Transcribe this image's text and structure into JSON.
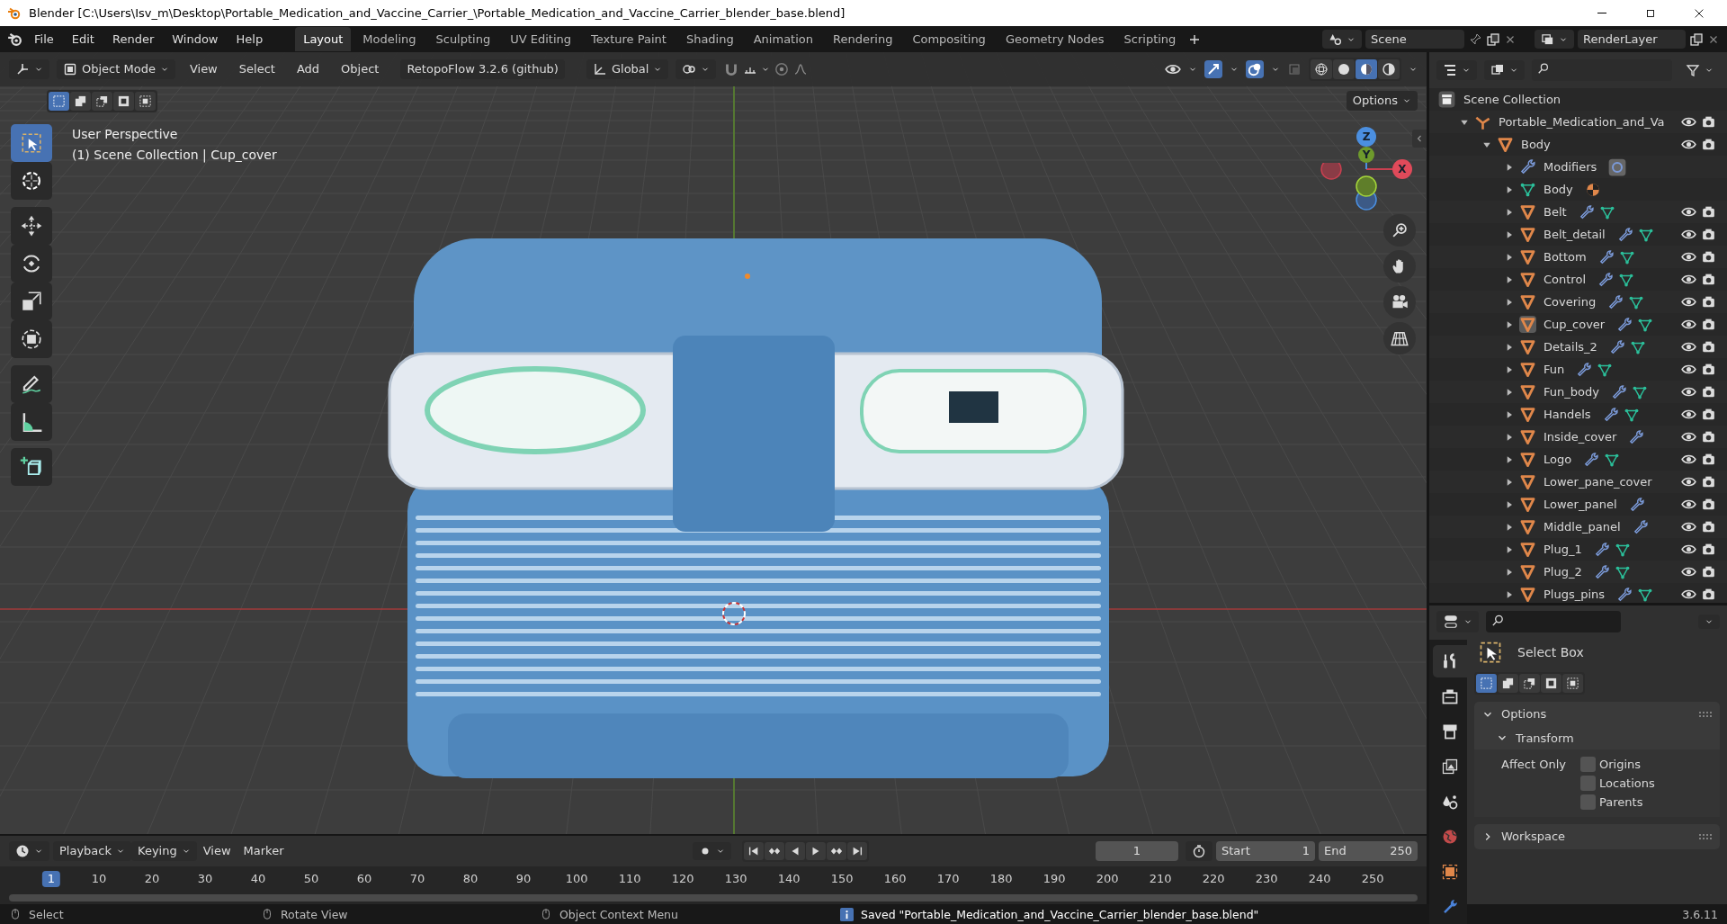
{
  "window": {
    "title": "Blender [C:\\Users\\Isv_m\\Desktop\\Portable_Medication_and_Vaccine_Carrier_\\Portable_Medication_and_Vaccine_Carrier_blender_base.blend]"
  },
  "menu": [
    "File",
    "Edit",
    "Render",
    "Window",
    "Help"
  ],
  "workspaces": [
    {
      "label": "Layout",
      "selected": true
    },
    {
      "label": "Modeling",
      "selected": false
    },
    {
      "label": "Sculpting",
      "selected": false
    },
    {
      "label": "UV Editing",
      "selected": false
    },
    {
      "label": "Texture Paint",
      "selected": false
    },
    {
      "label": "Shading",
      "selected": false
    },
    {
      "label": "Animation",
      "selected": false
    },
    {
      "label": "Rendering",
      "selected": false
    },
    {
      "label": "Compositing",
      "selected": false
    },
    {
      "label": "Geometry Nodes",
      "selected": false
    },
    {
      "label": "Scripting",
      "selected": false
    }
  ],
  "scene": {
    "name": "Scene",
    "view_layer": "RenderLayer"
  },
  "viewport_header": {
    "mode": "Object Mode",
    "menus": [
      "View",
      "Select",
      "Add",
      "Object"
    ],
    "addon": "RetopoFlow 3.2.6 (github)",
    "orientation": "Global",
    "shading": [
      {
        "kind": "wireframe",
        "selected": false
      },
      {
        "kind": "solid",
        "selected": false
      },
      {
        "kind": "material",
        "selected": true
      },
      {
        "kind": "rendered",
        "selected": false
      }
    ],
    "select_modes": [
      {
        "selected": true
      },
      {
        "selected": false
      },
      {
        "selected": false
      },
      {
        "selected": false
      },
      {
        "selected": false
      }
    ],
    "options": "Options"
  },
  "viewport": {
    "view_name": "User Perspective",
    "context": "(1) Scene Collection | Cup_cover",
    "tools": [
      {
        "kind": "select_box",
        "selected": true
      },
      {
        "kind": "cursor",
        "selected": false
      },
      {
        "kind": "move",
        "selected": false
      },
      {
        "kind": "rotate",
        "selected": false
      },
      {
        "kind": "scale",
        "selected": false
      },
      {
        "kind": "transform",
        "selected": false
      },
      {
        "kind": "annotate",
        "selected": false
      },
      {
        "kind": "measure",
        "selected": false
      },
      {
        "kind": "add_cube",
        "selected": false
      }
    ],
    "axes": [
      {
        "kind": "z",
        "label": "Z"
      },
      {
        "kind": "y",
        "label": "Y"
      },
      {
        "kind": "x",
        "label": "X"
      }
    ]
  },
  "outliner": {
    "root": "Scene Collection",
    "items": [
      {
        "name": "Portable_Medication_and_Va",
        "kind": "empty",
        "expanded": true,
        "children": [
          {
            "name": "Body",
            "kind": "object",
            "expanded": true,
            "active": false,
            "modifier": false,
            "mesh": false,
            "children": [
              {
                "name": "Modifiers",
                "kind": "modifiers",
                "expanded": false
              },
              {
                "name": "Body",
                "kind": "mesh_data",
                "expanded": false
              },
              {
                "name": "Belt",
                "kind": "object",
                "expanded": false,
                "active": false,
                "modifier": true,
                "mesh": true
              },
              {
                "name": "Belt_detail",
                "kind": "object",
                "expanded": false,
                "active": false,
                "modifier": true,
                "mesh": true
              },
              {
                "name": "Bottom",
                "kind": "object",
                "expanded": false,
                "active": false,
                "modifier": true,
                "mesh": true
              },
              {
                "name": "Control",
                "kind": "object",
                "expanded": false,
                "active": false,
                "modifier": true,
                "mesh": true
              },
              {
                "name": "Covering",
                "kind": "object",
                "expanded": false,
                "active": false,
                "modifier": true,
                "mesh": true
              },
              {
                "name": "Cup_cover",
                "kind": "object",
                "expanded": false,
                "active": true,
                "modifier": true,
                "mesh": true
              },
              {
                "name": "Details_2",
                "kind": "object",
                "expanded": false,
                "active": false,
                "modifier": true,
                "mesh": true
              },
              {
                "name": "Fun",
                "kind": "object",
                "expanded": false,
                "active": false,
                "modifier": true,
                "mesh": true
              },
              {
                "name": "Fun_body",
                "kind": "object",
                "expanded": false,
                "active": false,
                "modifier": true,
                "mesh": true
              },
              {
                "name": "Handels",
                "kind": "object",
                "expanded": false,
                "active": false,
                "modifier": true,
                "mesh": true
              },
              {
                "name": "Inside_cover",
                "kind": "object",
                "expanded": false,
                "active": false,
                "modifier": true,
                "mesh": false
              },
              {
                "name": "Logo",
                "kind": "object",
                "expanded": false,
                "active": false,
                "modifier": true,
                "mesh": true
              },
              {
                "name": "Lower_pane_cover",
                "kind": "object",
                "expanded": false,
                "active": false,
                "modifier": false,
                "mesh": false
              },
              {
                "name": "Lower_panel",
                "kind": "object",
                "expanded": false,
                "active": false,
                "modifier": true,
                "mesh": false
              },
              {
                "name": "Middle_panel",
                "kind": "object",
                "expanded": false,
                "active": false,
                "modifier": true,
                "mesh": false
              },
              {
                "name": "Plug_1",
                "kind": "object",
                "expanded": false,
                "active": false,
                "modifier": true,
                "mesh": true
              },
              {
                "name": "Plug_2",
                "kind": "object",
                "expanded": false,
                "active": false,
                "modifier": true,
                "mesh": true
              },
              {
                "name": "Plugs_pins",
                "kind": "object",
                "expanded": false,
                "active": false,
                "modifier": true,
                "mesh": true
              }
            ]
          }
        ]
      }
    ]
  },
  "properties": {
    "tabs": [
      {
        "kind": "tool",
        "selected": true
      },
      {
        "kind": "render",
        "selected": false
      },
      {
        "kind": "output",
        "selected": false
      },
      {
        "kind": "view_layer",
        "selected": false
      },
      {
        "kind": "scene",
        "selected": false
      },
      {
        "kind": "world",
        "selected": false
      },
      {
        "kind": "object",
        "selected": false
      },
      {
        "kind": "modifiers",
        "selected": false
      }
    ],
    "tool_name": "Select Box",
    "select_modes": [
      {
        "selected": true
      },
      {
        "selected": false
      },
      {
        "selected": false
      },
      {
        "selected": false
      },
      {
        "selected": false
      }
    ],
    "panels": [
      {
        "title": "Options",
        "expanded": true,
        "subpanels": [
          {
            "title": "Transform",
            "expanded": true,
            "field_label": "Affect Only",
            "options": [
              {
                "label": "Origins",
                "checked": false
              },
              {
                "label": "Locations",
                "checked": false
              },
              {
                "label": "Parents",
                "checked": false
              }
            ]
          }
        ]
      },
      {
        "title": "Workspace",
        "expanded": false
      }
    ]
  },
  "timeline": {
    "menus": [
      {
        "label": "Playback",
        "dropdown": true
      },
      {
        "label": "Keying",
        "dropdown": true
      },
      {
        "label": "View",
        "dropdown": false
      },
      {
        "label": "Marker",
        "dropdown": false
      }
    ],
    "current_frame": "1",
    "start_label": "Start",
    "start": "1",
    "end_label": "End",
    "end": "250",
    "ruler": [
      {
        "label": "1",
        "selected": true
      },
      {
        "label": "10",
        "selected": false
      },
      {
        "label": "20",
        "selected": false
      },
      {
        "label": "30",
        "selected": false
      },
      {
        "label": "40",
        "selected": false
      },
      {
        "label": "50",
        "selected": false
      },
      {
        "label": "60",
        "selected": false
      },
      {
        "label": "70",
        "selected": false
      },
      {
        "label": "80",
        "selected": false
      },
      {
        "label": "90",
        "selected": false
      },
      {
        "label": "100",
        "selected": false
      },
      {
        "label": "110",
        "selected": false
      },
      {
        "label": "120",
        "selected": false
      },
      {
        "label": "130",
        "selected": false
      },
      {
        "label": "140",
        "selected": false
      },
      {
        "label": "150",
        "selected": false
      },
      {
        "label": "160",
        "selected": false
      },
      {
        "label": "170",
        "selected": false
      },
      {
        "label": "180",
        "selected": false
      },
      {
        "label": "190",
        "selected": false
      },
      {
        "label": "200",
        "selected": false
      },
      {
        "label": "210",
        "selected": false
      },
      {
        "label": "220",
        "selected": false
      },
      {
        "label": "230",
        "selected": false
      },
      {
        "label": "240",
        "selected": false
      },
      {
        "label": "250",
        "selected": false
      }
    ]
  },
  "status_bar": {
    "hints": [
      {
        "kind": "left",
        "label": "Select"
      },
      {
        "kind": "middle",
        "label": "Rotate View"
      },
      {
        "kind": "right",
        "label": "Object Context Menu"
      }
    ],
    "message": "Saved \"Portable_Medication_and_Vaccine_Carrier_blender_base.blend\"",
    "version": "3.6.11"
  }
}
